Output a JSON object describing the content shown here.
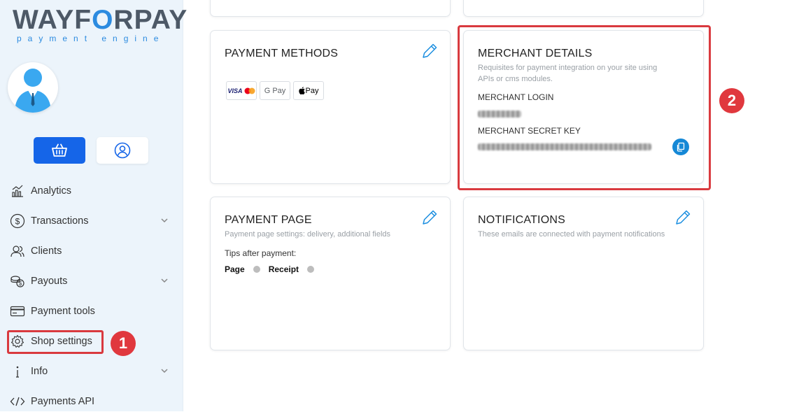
{
  "brand": {
    "name_part1": "WAYF",
    "name_part2": "O",
    "name_part3": "RPAY",
    "tagline": "payment engine",
    "accent": "#2c8be0"
  },
  "sidebar": {
    "nav": [
      {
        "label": "Analytics",
        "icon": "analytics-icon",
        "has_chevron": false
      },
      {
        "label": "Transactions",
        "icon": "dollar-circle-icon",
        "has_chevron": true
      },
      {
        "label": "Clients",
        "icon": "users-icon",
        "has_chevron": false
      },
      {
        "label": "Payouts",
        "icon": "coins-icon",
        "has_chevron": true
      },
      {
        "label": "Payment tools",
        "icon": "card-icon",
        "has_chevron": false
      },
      {
        "label": "Shop settings",
        "icon": "gear-icon",
        "has_chevron": false
      },
      {
        "label": "Info",
        "icon": "info-icon",
        "has_chevron": true
      },
      {
        "label": "Payments API",
        "icon": "code-icon",
        "has_chevron": false
      }
    ]
  },
  "annotations": {
    "step1": "1",
    "step2": "2",
    "color": "#d93a3f"
  },
  "cards": {
    "payment_methods": {
      "title": "PAYMENT METHODS",
      "methods": [
        "VISA",
        "G Pay",
        "Pay"
      ]
    },
    "merchant_details": {
      "title": "MERCHANT DETAILS",
      "subtitle": "Requisites for payment integration on your site using APIs or cms modules.",
      "login_label": "MERCHANT LOGIN",
      "secret_label": "MERCHANT SECRET KEY"
    },
    "payment_page": {
      "title": "PAYMENT PAGE",
      "subtitle": "Payment page settings: delivery, additional fields",
      "tips_label": "Tips after payment:",
      "option_page": "Page",
      "option_receipt": "Receipt"
    },
    "notifications": {
      "title": "NOTIFICATIONS",
      "subtitle": "These emails are connected with payment notifications"
    }
  }
}
